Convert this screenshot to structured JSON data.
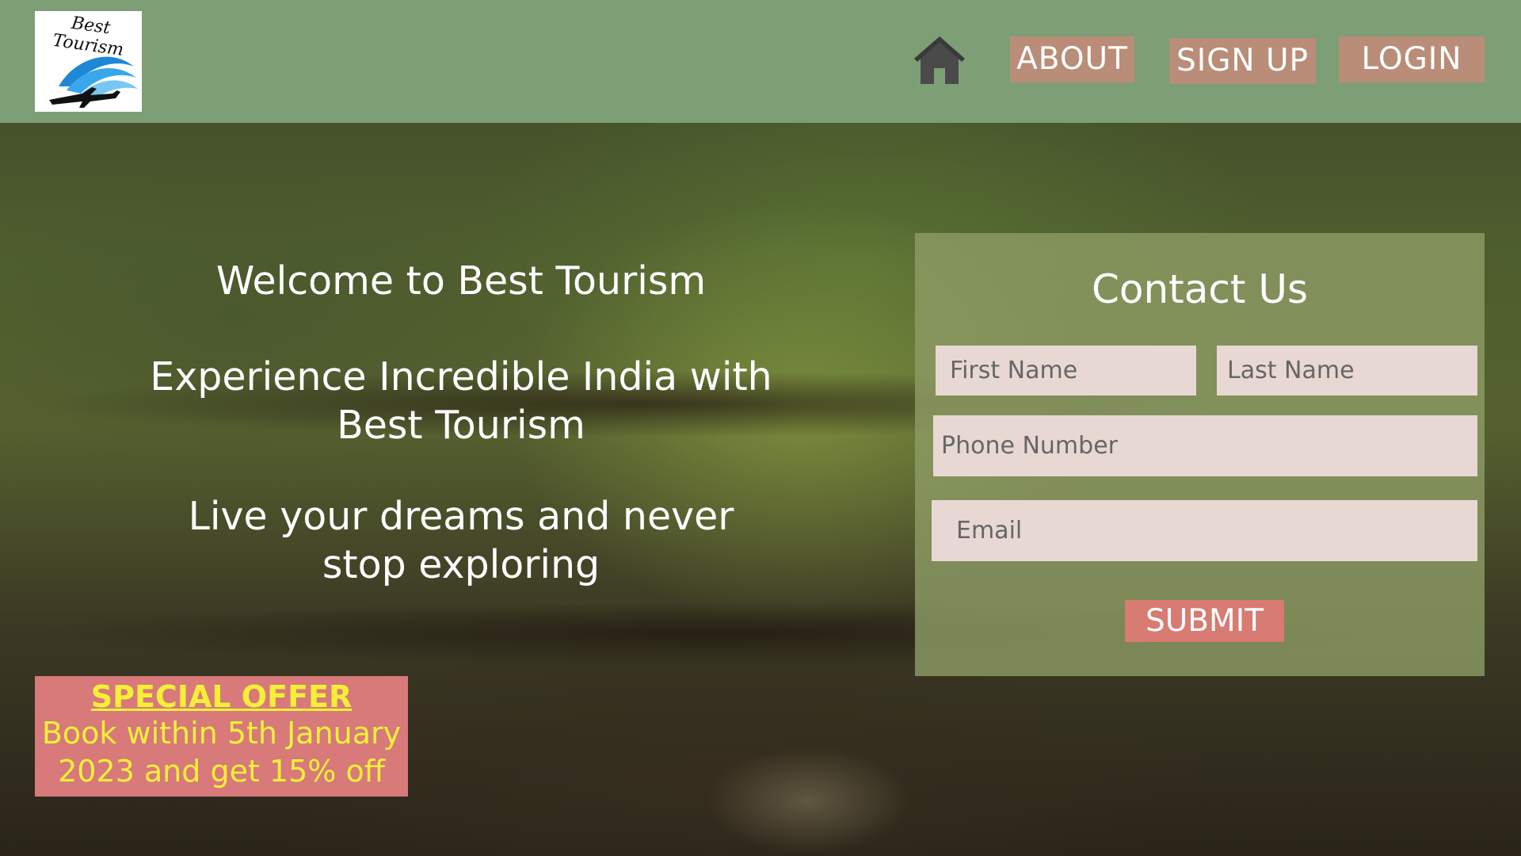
{
  "header": {
    "logo_text": "Best Tourism",
    "nav": {
      "home_icon": "home-icon",
      "about_label": "ABOUT",
      "signup_label": "SIGN UP",
      "login_label": "LOGIN"
    }
  },
  "hero": {
    "line1": "Welcome to Best Tourism",
    "line2": "Experience Incredible India with Best Tourism",
    "line3": "Live your dreams and never stop exploring"
  },
  "contact": {
    "title": "Contact Us",
    "first_name_placeholder": "First Name",
    "last_name_placeholder": "Last Name",
    "phone_placeholder": "Phone Number",
    "email_placeholder": "Email",
    "submit_label": "SUBMIT"
  },
  "offer": {
    "title": "SPECIAL OFFER",
    "body": "Book within 5th January 2023 and get 15% off"
  },
  "colors": {
    "header_bg": "#7e9f76",
    "nav_button_bg": "#b98d77",
    "submit_bg": "#d77b73",
    "offer_bg": "#d8797a",
    "offer_text": "#f4f037",
    "field_bg": "#e8d8d4"
  }
}
